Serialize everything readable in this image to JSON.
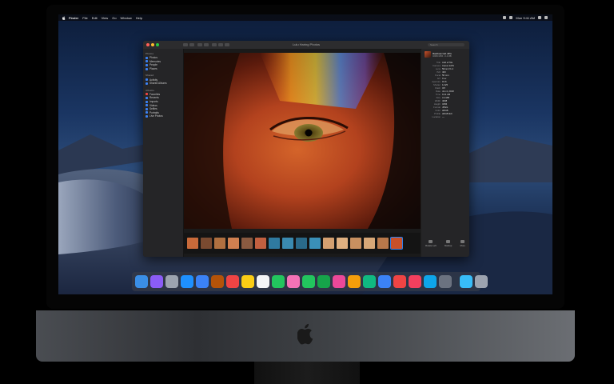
{
  "menubar": {
    "app_name": "Finder",
    "items": [
      "File",
      "Edit",
      "View",
      "Go",
      "Window",
      "Help"
    ],
    "clock": "Mon 9:41 AM"
  },
  "window": {
    "title": "Lulu Haring Photos"
  },
  "sidebar": {
    "sections": [
      {
        "heading": "Photos",
        "items": [
          "Photos",
          "Memories",
          "People",
          "Places"
        ]
      },
      {
        "heading": "Shared",
        "items": [
          "Activity",
          "Shared Albums"
        ]
      },
      {
        "heading": "Albums",
        "items": [
          "Favorites",
          "Recents",
          "Imports",
          "Videos",
          "Selfies",
          "Portraits",
          "Live Photos"
        ]
      }
    ]
  },
  "search": {
    "placeholder": "Search"
  },
  "info_panel": {
    "title": "Rainbow Girl.JPG",
    "subtitle": "4608×3456 • 3.4 MB",
    "rows": [
      {
        "k": "Title",
        "v": "Add a Title"
      },
      {
        "k": "Camera",
        "v": "Canon EOS"
      },
      {
        "k": "Lens",
        "v": "50mm f/1.4"
      },
      {
        "k": "ISO",
        "v": "400"
      },
      {
        "k": "Focal",
        "v": "50 mm"
      },
      {
        "k": "EV",
        "v": "0 ev"
      },
      {
        "k": "Aperture",
        "v": "f/2.8"
      },
      {
        "k": "Shutter",
        "v": "1/125"
      },
      {
        "k": "Flash",
        "v": "Off"
      },
      {
        "k": "Date",
        "v": "Jun 4, 2018"
      },
      {
        "k": "Time",
        "v": "9:41 AM"
      },
      {
        "k": "Size",
        "v": "3.4 MB"
      },
      {
        "k": "Width",
        "v": "4608"
      },
      {
        "k": "Height",
        "v": "3456"
      },
      {
        "k": "Format",
        "v": "JPEG"
      },
      {
        "k": "Color",
        "v": "sRGB"
      },
      {
        "k": "Profile",
        "v": "sRGB IEC"
      },
      {
        "k": "Location",
        "v": "—"
      }
    ],
    "actions": [
      "Rotate Left",
      "Markup",
      "More"
    ]
  },
  "dock": {
    "icons": [
      "finder-icon",
      "siri-icon",
      "launchpad-icon",
      "safari-icon",
      "mail-icon",
      "contacts-icon",
      "calendar-icon",
      "notes-icon",
      "reminders-icon",
      "maps-icon",
      "photos-icon",
      "messages-icon",
      "facetime-icon",
      "itunes-icon",
      "books-icon",
      "numbers-icon",
      "keynote-icon",
      "news-icon",
      "music-icon",
      "appstore-icon",
      "preferences-icon",
      "downloads-icon",
      "trash-icon"
    ],
    "colors": [
      "#3a8ee6",
      "#8b5cf6",
      "#9ca3af",
      "#1e90ff",
      "#3b82f6",
      "#b45309",
      "#ef4444",
      "#facc15",
      "#f3f4f6",
      "#22c55e",
      "#f472b6",
      "#22c55e",
      "#16a34a",
      "#ec4899",
      "#f59e0b",
      "#10b981",
      "#3b82f6",
      "#ef4444",
      "#f43f5e",
      "#0ea5e9",
      "#6b7280",
      "#38bdf8",
      "#9ca3af"
    ]
  }
}
